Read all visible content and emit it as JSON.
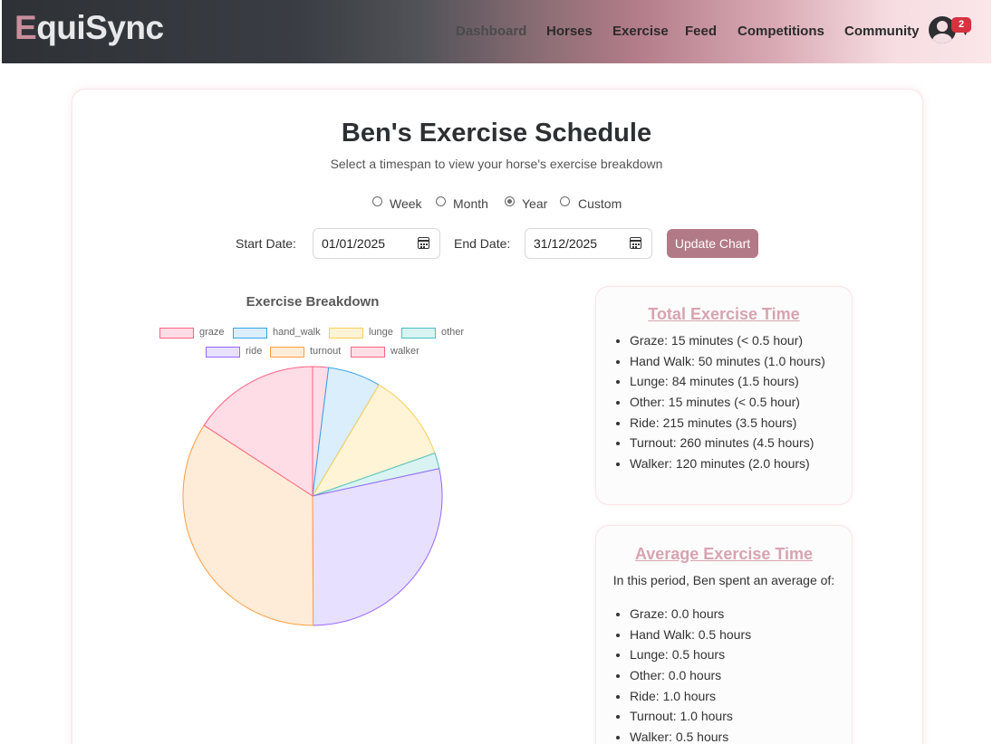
{
  "app": {
    "logo_first": "E",
    "logo_rest": "quiSync"
  },
  "nav": {
    "items": [
      "Dashboard",
      "Horses",
      "Exercise",
      "Feed",
      "Competitions",
      "Community"
    ],
    "notification_count": "2",
    "avatar_icon": "user-circle-icon"
  },
  "page": {
    "title": "Ben's Exercise Schedule",
    "subtitle": "Select a timespan to view your horse's exercise breakdown"
  },
  "timespan": {
    "options": [
      "Week",
      "Month",
      "Year",
      "Custom"
    ],
    "selected": "Year"
  },
  "dates": {
    "start_label": "Start Date:",
    "start_value": "01/01/2025",
    "end_label": "End Date:",
    "end_value": "31/12/2025",
    "update_label": "Update Chart"
  },
  "chart_data": {
    "type": "pie",
    "title": "Exercise Breakdown",
    "legend_position": "top",
    "categories": [
      "graze",
      "hand_walk",
      "lunge",
      "other",
      "ride",
      "turnout",
      "walker"
    ],
    "values": [
      15,
      50,
      84,
      15,
      215,
      260,
      120
    ],
    "colors": {
      "fill": [
        "#ffdde6",
        "#dbeefb",
        "#fff4d6",
        "#d8f3f1",
        "#e7e0ff",
        "#ffecd8",
        "#ffdde6"
      ],
      "border": [
        "#ff6384",
        "#36a2eb",
        "#ffcd56",
        "#4bc0c0",
        "#9966ff",
        "#ff9f40",
        "#ff6384"
      ]
    }
  },
  "total_panel": {
    "title": "Total Exercise Time",
    "items": [
      "Graze: 15 minutes (< 0.5 hour)",
      "Hand Walk: 50 minutes (1.0 hours)",
      "Lunge: 84 minutes (1.5 hours)",
      "Other: 15 minutes (< 0.5 hour)",
      "Ride: 215 minutes (3.5 hours)",
      "Turnout: 260 minutes (4.5 hours)",
      "Walker: 120 minutes (2.0 hours)"
    ]
  },
  "average_panel": {
    "title": "Average Exercise Time",
    "intro": "In this period, Ben spent an average of:",
    "items": [
      "Graze: 0.0 hours",
      "Hand Walk: 0.5 hours",
      "Lunge: 0.5 hours",
      "Other: 0.0 hours",
      "Ride: 1.0 hours",
      "Turnout: 1.0 hours",
      "Walker: 0.5 hours"
    ]
  }
}
